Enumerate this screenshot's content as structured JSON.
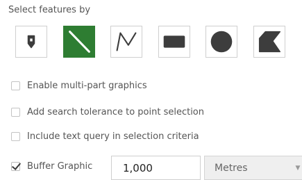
{
  "heading": "Select features by",
  "tools": [
    {
      "icon": "point-icon",
      "active": false
    },
    {
      "icon": "line-icon",
      "active": true
    },
    {
      "icon": "polyline-icon",
      "active": false
    },
    {
      "icon": "rectangle-icon",
      "active": false
    },
    {
      "icon": "circle-icon",
      "active": false
    },
    {
      "icon": "polygon-icon",
      "active": false
    }
  ],
  "options": {
    "multipart": {
      "label": "Enable multi-part graphics",
      "checked": false
    },
    "tolerance": {
      "label": "Add search tolerance to point selection",
      "checked": false
    },
    "text_query": {
      "label": "Include text query in selection criteria",
      "checked": false
    },
    "buffer": {
      "label": "Buffer Graphic",
      "checked": true
    }
  },
  "buffer": {
    "value": "1,000",
    "unit": "Metres"
  },
  "colors": {
    "active_tool": "#2e7d32",
    "icon": "#3d3d3d",
    "active_icon": "#ffffff"
  }
}
